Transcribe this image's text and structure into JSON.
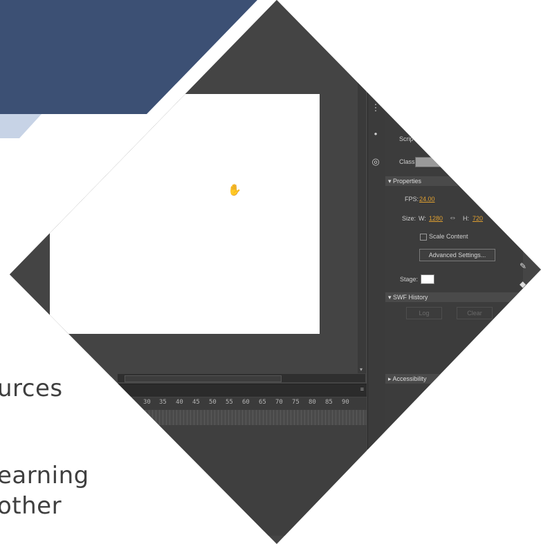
{
  "slide": {
    "text_lines": [
      "urces",
      "earning",
      "other"
    ]
  },
  "timeline": {
    "frame_numbers": [
      "30",
      "35",
      "40",
      "45",
      "50",
      "55",
      "60",
      "65",
      "70",
      "75",
      "80",
      "85",
      "90"
    ]
  },
  "properties_panel": {
    "script_label": "Scrip",
    "class_label": "Class:",
    "properties_header": "▾ Properties",
    "fps_label": "FPS:",
    "fps_value": "24.00",
    "size_label": "Size:",
    "w_label": "W:",
    "w_value": "1280",
    "h_label": "H:",
    "h_value": "720",
    "scale_content_label": "Scale Content",
    "advanced_settings_label": "Advanced Settings...",
    "stage_label": "Stage:",
    "swf_history_header": "▾ SWF History",
    "log_label": "Log",
    "clear_label": "Clear",
    "accessibility_header": "▸ Accessibility"
  },
  "colors": {
    "banner_dark": "#3c5074",
    "banner_light": "#c7d3e6",
    "app_background": "#454545",
    "fps_accent": "#e0a030"
  }
}
